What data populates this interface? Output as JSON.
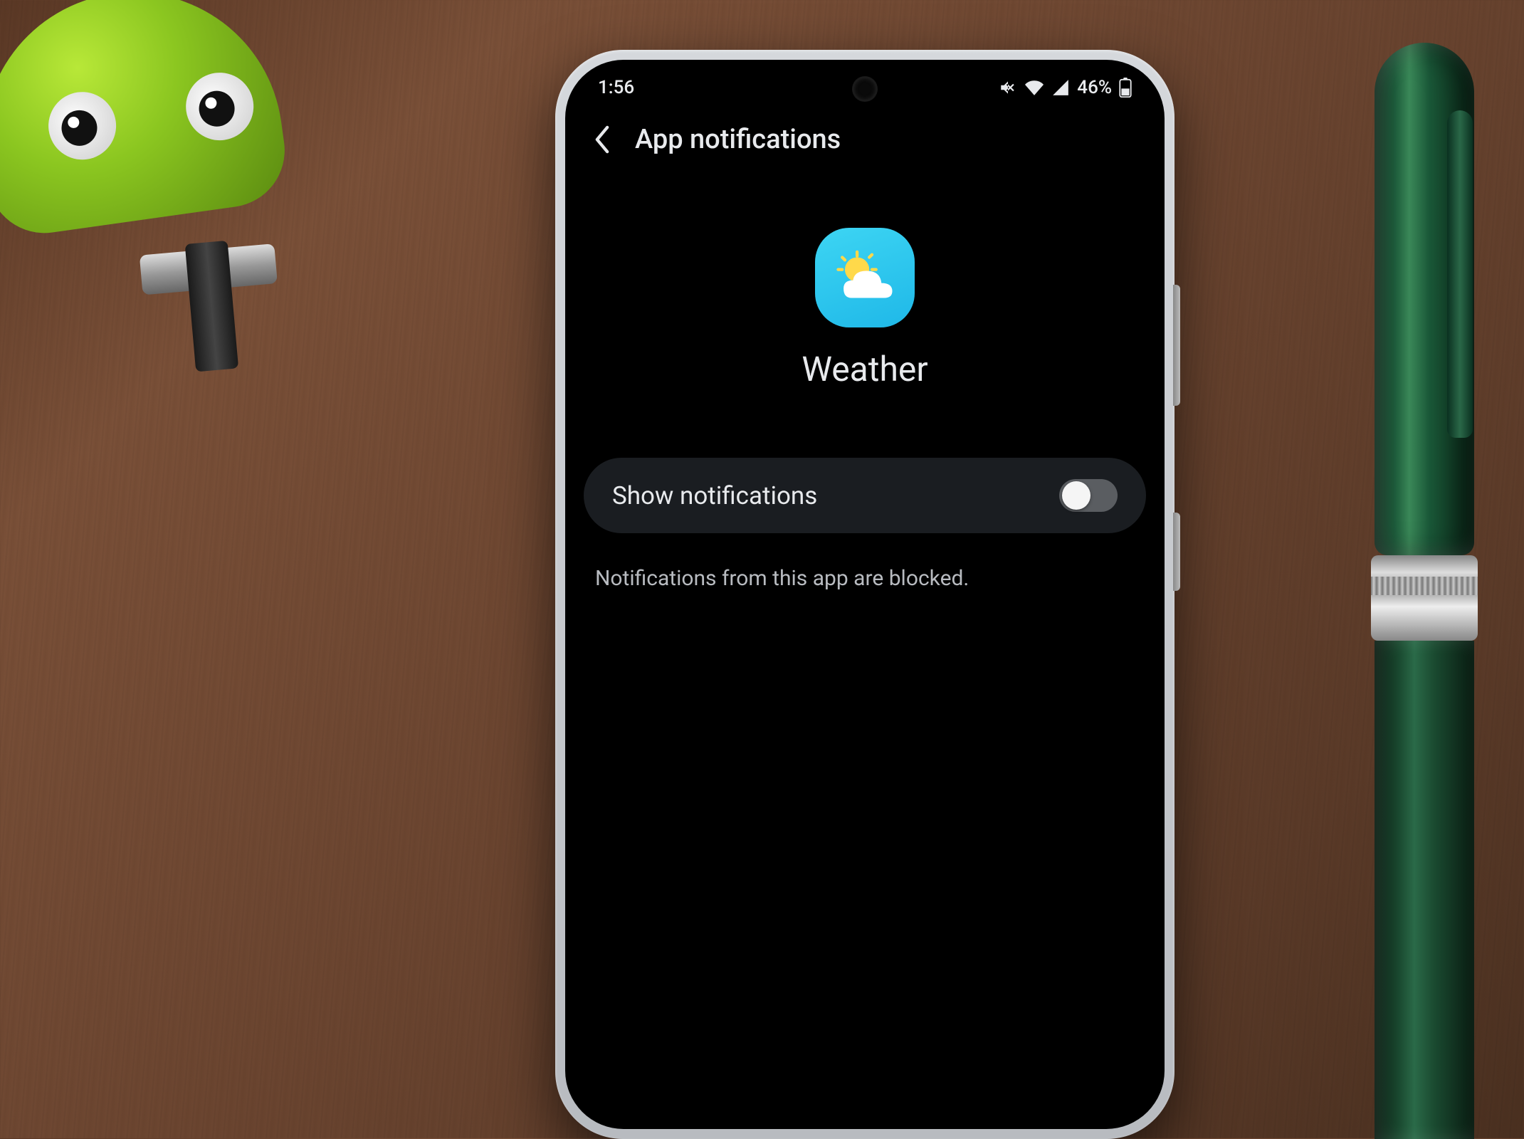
{
  "status_bar": {
    "time": "1:56",
    "battery_percent": "46%",
    "icons": {
      "mute": "mute-icon",
      "wifi": "wifi-icon",
      "signal": "signal-icon",
      "battery": "battery-icon"
    }
  },
  "header": {
    "title": "App notifications"
  },
  "app": {
    "name": "Weather",
    "icon_semantic": "weather-sun-cloud-icon"
  },
  "toggle": {
    "label": "Show notifications",
    "state": "off"
  },
  "blocked_message": "Notifications from this app are blocked.",
  "colors": {
    "app_icon_bg": "#24c5ed",
    "text_primary": "#e8eaed",
    "text_secondary": "#b8bbc0",
    "row_bg": "#1a1d21",
    "toggle_off_track": "#5a5d61"
  }
}
